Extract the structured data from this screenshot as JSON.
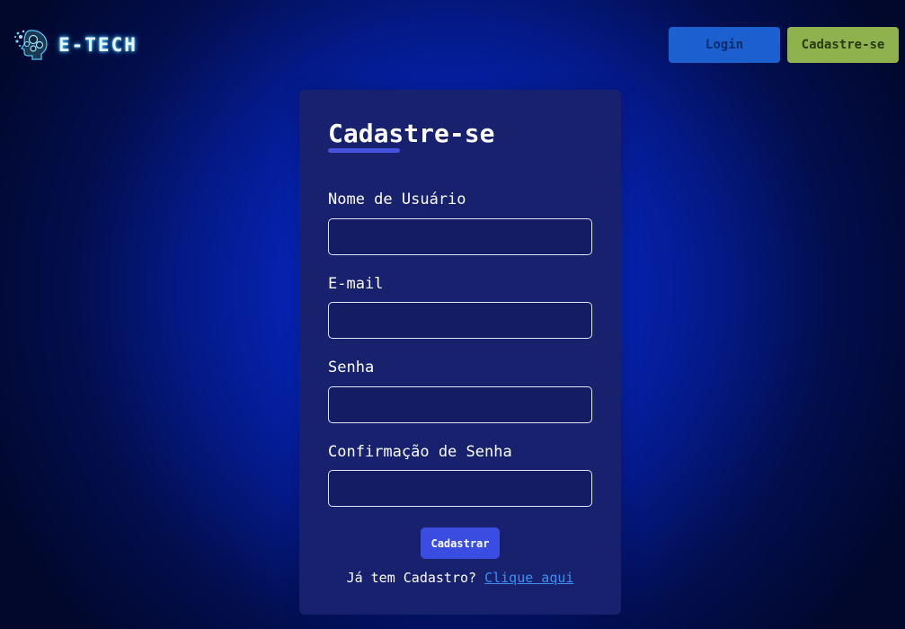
{
  "header": {
    "brand_name": "E-TECH",
    "logo_icon": "circuit-head-icon",
    "login_label": "Login",
    "signup_label": "Cadastre-se"
  },
  "form": {
    "title": "Cadastre-se",
    "fields": [
      {
        "label": "Nome de Usuário",
        "value": "",
        "placeholder": ""
      },
      {
        "label": "E-mail",
        "value": "",
        "placeholder": ""
      },
      {
        "label": "Senha",
        "value": "",
        "placeholder": ""
      },
      {
        "label": "Confirmação de Senha",
        "value": "",
        "placeholder": ""
      }
    ],
    "submit_label": "Cadastrar",
    "footer_text": "Já tem Cadastro?",
    "footer_link": "Clique aqui"
  },
  "colors": {
    "accent": "#3b4de0",
    "login_button": "#1c5fcf",
    "signup_button": "#8fb14e",
    "card": "#18216e",
    "link": "#3c8ff0"
  }
}
